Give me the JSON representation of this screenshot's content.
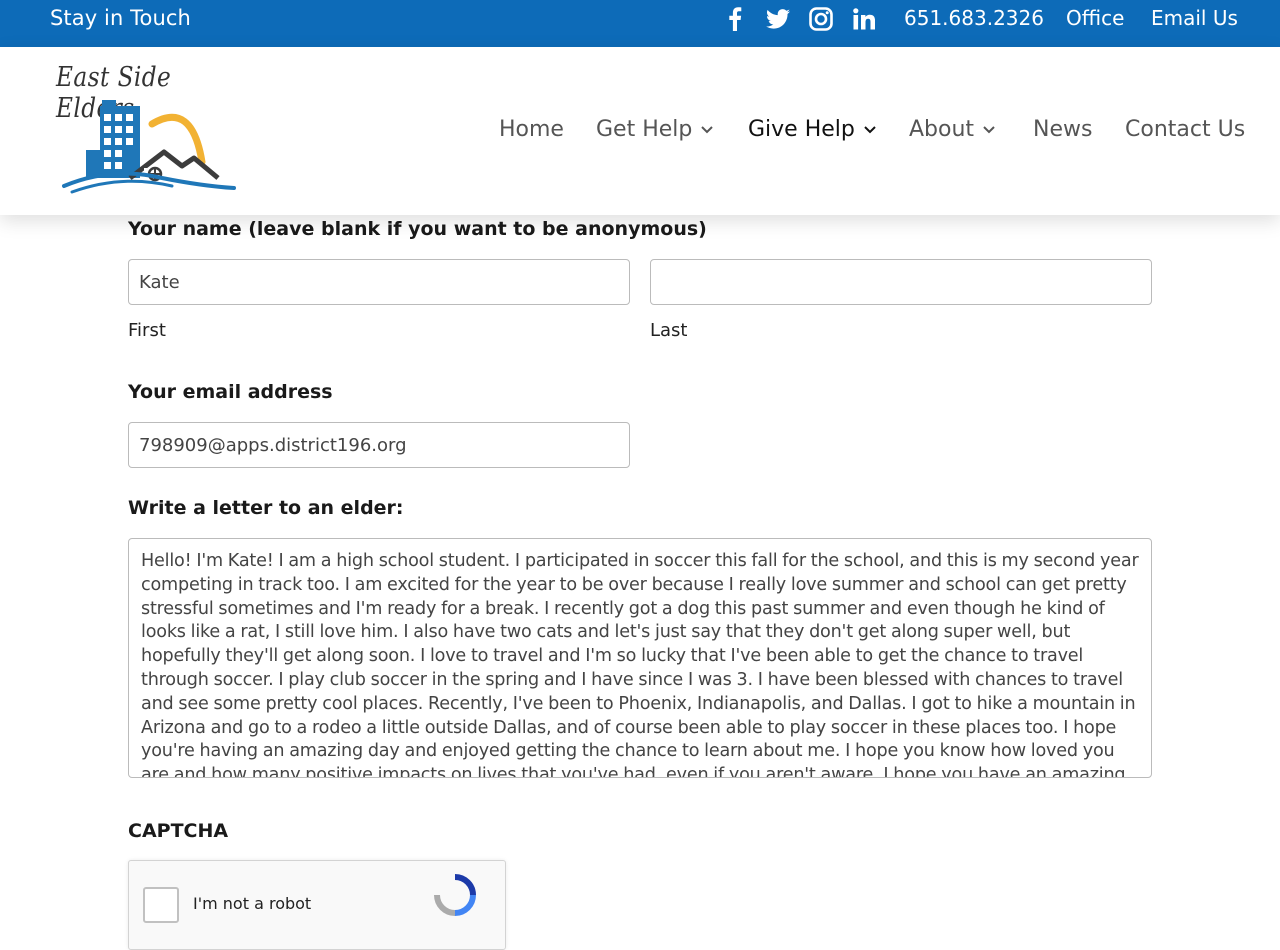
{
  "topbar": {
    "title": "Stay in Touch",
    "social": [
      {
        "icon": "facebook-icon"
      },
      {
        "icon": "twitter-icon"
      },
      {
        "icon": "instagram-icon"
      },
      {
        "icon": "linkedin-icon"
      }
    ],
    "phone": "651.683.2326",
    "office": "Office",
    "email": "Email Us"
  },
  "header": {
    "logo_text": "East Side Elders",
    "nav": [
      {
        "label": "Home",
        "has_dropdown": false,
        "active": false
      },
      {
        "label": "Get Help",
        "has_dropdown": true,
        "active": false
      },
      {
        "label": "Give Help",
        "has_dropdown": true,
        "active": true
      },
      {
        "label": "About",
        "has_dropdown": true,
        "active": false
      },
      {
        "label": "News",
        "has_dropdown": false,
        "active": false
      },
      {
        "label": "Contact Us",
        "has_dropdown": false,
        "active": false
      }
    ]
  },
  "form": {
    "name_label": "Your name (leave blank if you want to be anonymous)",
    "first_value": "Kate",
    "first_label": "First",
    "last_value": "",
    "last_label": "Last",
    "email_label": "Your email address",
    "email_value": "798909@apps.district196.org",
    "letter_label": "Write a letter to an elder:",
    "letter_value": "Hello! I'm Kate! I am a high school student. I participated in soccer this fall for the school, and this is my second year competing in track too. I am excited for the year to be over because I really love summer and school can get pretty stressful sometimes and I'm ready for a break. I recently got a dog this past summer and even though he kind of looks like a rat, I still love him. I also have two cats and let's just say that they don't get along super well, but hopefully they'll get along soon. I love to travel and I'm so lucky that I've been able to get the chance to travel through soccer. I play club soccer in the spring and I have since I was 3. I have been blessed with chances to travel and see some pretty cool places. Recently, I've been to Phoenix, Indianapolis, and Dallas. I got to hike a mountain in Arizona and go to a rodeo a little outside Dallas, and of course been able to play soccer in these places too. I hope you're having an amazing day and enjoyed getting the chance to learn about me. I hope you know how loved you are and how many positive impacts on lives that you've had, even if you aren't aware. I hope you have an amazing",
    "captcha_label": "CAPTCHA",
    "captcha_text": "I'm not a robot"
  },
  "colors": {
    "topbar_bg": "#0d6bb8",
    "logo_blue": "#1f77b8",
    "logo_sun": "#f2b233"
  }
}
